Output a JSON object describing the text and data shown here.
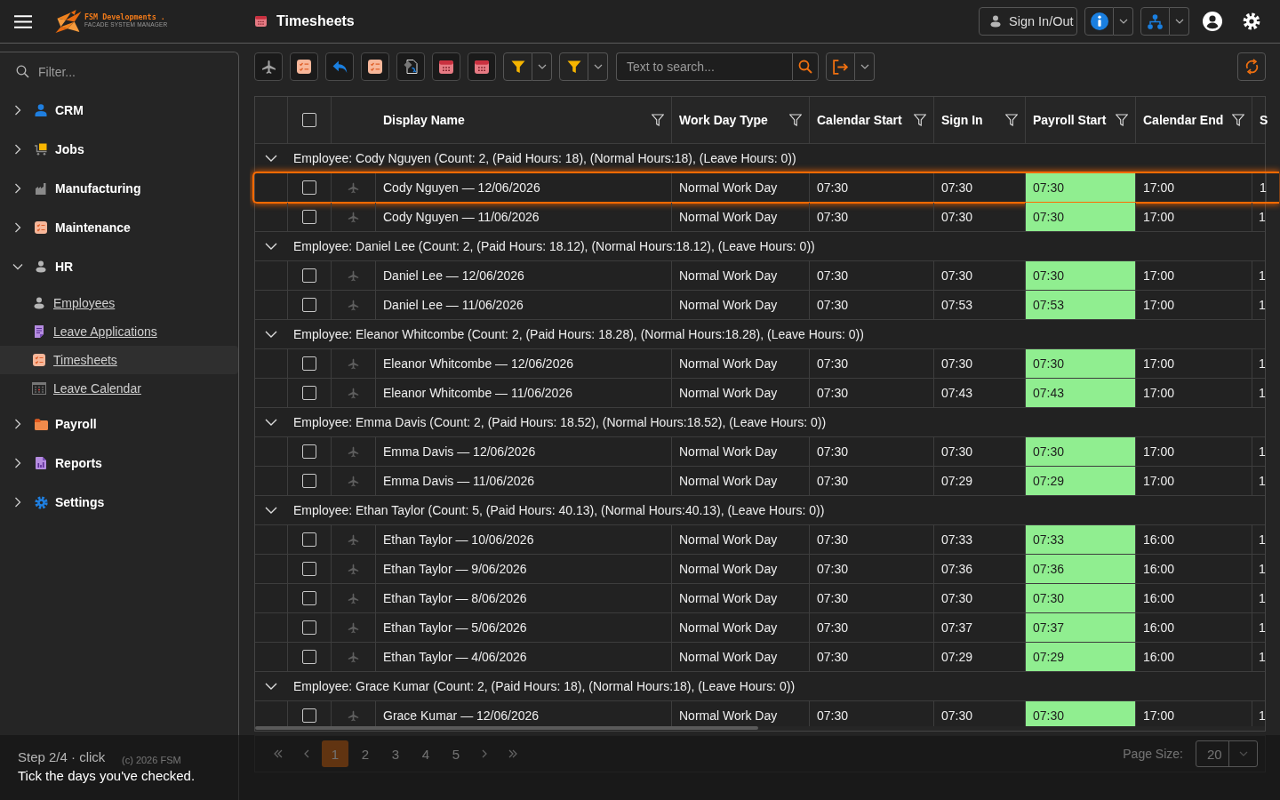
{
  "header": {
    "logo_name": "FSM Developments .",
    "logo_tagline": "FACADE SYSTEM MANAGER",
    "page_title": "Timesheets",
    "sign_button": "Sign In/Out"
  },
  "sidebar": {
    "filter": {
      "placeholder": "Filter..."
    },
    "items": [
      {
        "label": "CRM",
        "expanded": false
      },
      {
        "label": "Jobs",
        "expanded": false
      },
      {
        "label": "Manufacturing",
        "expanded": false
      },
      {
        "label": "Maintenance",
        "expanded": false
      },
      {
        "label": "HR",
        "expanded": true,
        "children": [
          {
            "label": "Employees",
            "selected": false
          },
          {
            "label": "Leave Applications",
            "selected": false
          },
          {
            "label": "Timesheets",
            "selected": true
          },
          {
            "label": "Leave Calendar",
            "selected": false
          }
        ]
      },
      {
        "label": "Payroll",
        "expanded": false
      },
      {
        "label": "Reports",
        "expanded": false
      },
      {
        "label": "Settings",
        "expanded": false
      }
    ],
    "footer": "(c) 2026 FSM"
  },
  "toolbar": {
    "search": {
      "placeholder": "Text to search..."
    }
  },
  "grid": {
    "select_all": {
      "checked": false
    },
    "columns": [
      {
        "label": "Display Name",
        "highlight": false
      },
      {
        "label": "Work Day Type",
        "highlight": false
      },
      {
        "label": "Calendar Start",
        "highlight": false
      },
      {
        "label": "Sign In",
        "highlight": false
      },
      {
        "label": "Payroll Start",
        "highlight": true
      },
      {
        "label": "Calendar End",
        "highlight": false
      },
      {
        "label": "S",
        "highlight": false
      }
    ],
    "groups": [
      {
        "label": "Employee: Cody Nguyen (Count: 2, (Paid Hours: 18), (Normal Hours:18), (Leave Hours: 0))",
        "expanded": true,
        "rows": [
          {
            "checked": false,
            "highlighted": true,
            "cells": [
              "Cody Nguyen — 12/06/2026",
              "Normal Work Day",
              "07:30",
              "07:30",
              "07:30",
              "17:00",
              "1"
            ]
          },
          {
            "checked": false,
            "highlighted": false,
            "cells": [
              "Cody Nguyen — 11/06/2026",
              "Normal Work Day",
              "07:30",
              "07:30",
              "07:30",
              "17:00",
              "1"
            ]
          }
        ]
      },
      {
        "label": "Employee: Daniel Lee (Count: 2, (Paid Hours: 18.12), (Normal Hours:18.12), (Leave Hours: 0))",
        "expanded": true,
        "rows": [
          {
            "checked": false,
            "highlighted": false,
            "cells": [
              "Daniel Lee — 12/06/2026",
              "Normal Work Day",
              "07:30",
              "07:30",
              "07:30",
              "17:00",
              "1"
            ]
          },
          {
            "checked": false,
            "highlighted": false,
            "cells": [
              "Daniel Lee — 11/06/2026",
              "Normal Work Day",
              "07:30",
              "07:53",
              "07:53",
              "17:00",
              "1"
            ]
          }
        ]
      },
      {
        "label": "Employee: Eleanor Whitcombe (Count: 2, (Paid Hours: 18.28), (Normal Hours:18.28), (Leave Hours: 0))",
        "expanded": true,
        "rows": [
          {
            "checked": false,
            "highlighted": false,
            "cells": [
              "Eleanor Whitcombe — 12/06/2026",
              "Normal Work Day",
              "07:30",
              "07:30",
              "07:30",
              "17:00",
              "1"
            ]
          },
          {
            "checked": false,
            "highlighted": false,
            "cells": [
              "Eleanor Whitcombe — 11/06/2026",
              "Normal Work Day",
              "07:30",
              "07:43",
              "07:43",
              "17:00",
              "1"
            ]
          }
        ]
      },
      {
        "label": "Employee: Emma Davis (Count: 2, (Paid Hours: 18.52), (Normal Hours:18.52), (Leave Hours: 0))",
        "expanded": true,
        "rows": [
          {
            "checked": false,
            "highlighted": false,
            "cells": [
              "Emma Davis — 12/06/2026",
              "Normal Work Day",
              "07:30",
              "07:30",
              "07:30",
              "17:00",
              "1"
            ]
          },
          {
            "checked": false,
            "highlighted": false,
            "cells": [
              "Emma Davis — 11/06/2026",
              "Normal Work Day",
              "07:30",
              "07:29",
              "07:29",
              "17:00",
              "1"
            ]
          }
        ]
      },
      {
        "label": "Employee: Ethan Taylor (Count: 5, (Paid Hours: 40.13), (Normal Hours:40.13), (Leave Hours: 0))",
        "expanded": true,
        "rows": [
          {
            "checked": false,
            "highlighted": false,
            "cells": [
              "Ethan Taylor — 10/06/2026",
              "Normal Work Day",
              "07:30",
              "07:33",
              "07:33",
              "16:00",
              "1"
            ]
          },
          {
            "checked": false,
            "highlighted": false,
            "cells": [
              "Ethan Taylor — 9/06/2026",
              "Normal Work Day",
              "07:30",
              "07:36",
              "07:36",
              "16:00",
              "1"
            ]
          },
          {
            "checked": false,
            "highlighted": false,
            "cells": [
              "Ethan Taylor — 8/06/2026",
              "Normal Work Day",
              "07:30",
              "07:30",
              "07:30",
              "16:00",
              "1"
            ]
          },
          {
            "checked": false,
            "highlighted": false,
            "cells": [
              "Ethan Taylor — 5/06/2026",
              "Normal Work Day",
              "07:30",
              "07:37",
              "07:37",
              "16:00",
              "1"
            ]
          },
          {
            "checked": false,
            "highlighted": false,
            "cells": [
              "Ethan Taylor — 4/06/2026",
              "Normal Work Day",
              "07:30",
              "07:29",
              "07:29",
              "16:00",
              "1"
            ]
          }
        ]
      },
      {
        "label": "Employee: Grace Kumar (Count: 2, (Paid Hours: 18), (Normal Hours:18), (Leave Hours: 0))",
        "expanded": true,
        "rows": [
          {
            "checked": false,
            "highlighted": false,
            "cells": [
              "Grace Kumar — 12/06/2026",
              "Normal Work Day",
              "07:30",
              "07:30",
              "07:30",
              "17:00",
              "1"
            ]
          }
        ]
      }
    ]
  },
  "pager": {
    "pages": [
      {
        "label": "1",
        "selected": true
      },
      {
        "label": "2",
        "selected": false
      },
      {
        "label": "3",
        "selected": false
      },
      {
        "label": "4",
        "selected": false
      },
      {
        "label": "5",
        "selected": false
      }
    ],
    "page_size_label": "Page Size:",
    "page_size": "20"
  },
  "tutorial": {
    "step": "Step 2/4 · click",
    "message": "Tick the days you've checked."
  }
}
